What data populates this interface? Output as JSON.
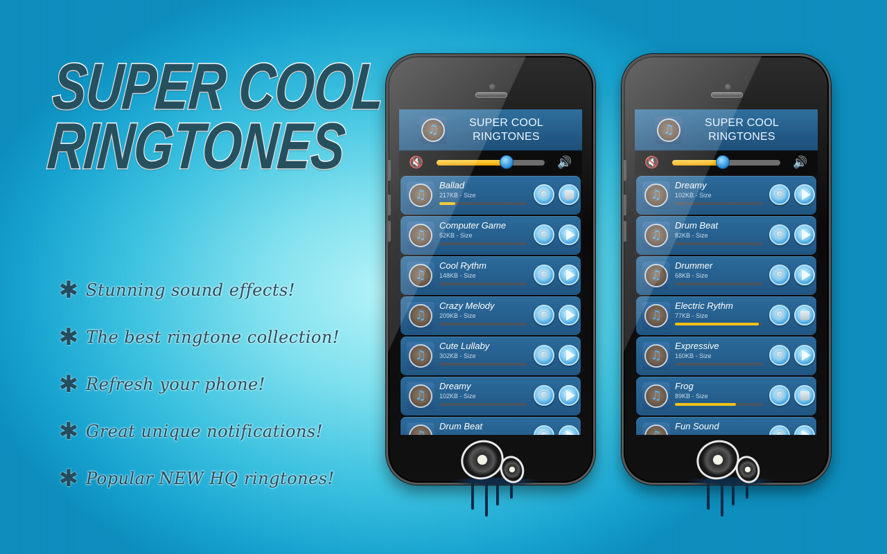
{
  "promo": {
    "title_line1": "SUPER COOL",
    "title_line2": "RINGTONES",
    "bullet_glyph": "✱",
    "features": [
      "Stunning sound effects!",
      "The best ringtone collection!",
      "Refresh your phone!",
      "Great unique notifications!",
      "Popular NEW HQ ringtones!"
    ]
  },
  "icons": {
    "music_note": "♫",
    "mute": "🔇",
    "volume": "🔊",
    "gear": "⚙"
  },
  "colors": {
    "progress_fill": "#f3c21b",
    "accent_blue": "#2a8fd9",
    "title_dark": "#27505f"
  },
  "phones": [
    {
      "app_title_line1": "SUPER COOL",
      "app_title_line2": "RINGTONES",
      "volume_percent": 65,
      "songs": [
        {
          "name": "Ballad",
          "size": "217KB - Size",
          "progress": 0.18,
          "state": "stop"
        },
        {
          "name": "Computer Game",
          "size": "52KB - Size",
          "progress": 0,
          "state": "play"
        },
        {
          "name": "Cool Rythm",
          "size": "148KB - Size",
          "progress": 0,
          "state": "play"
        },
        {
          "name": "Crazy Melody",
          "size": "209KB - Size",
          "progress": 0,
          "state": "play"
        },
        {
          "name": "Cute Lullaby",
          "size": "302KB - Size",
          "progress": 0,
          "state": "play"
        },
        {
          "name": "Dreamy",
          "size": "102KB - Size",
          "progress": 0,
          "state": "play"
        },
        {
          "name": "Drum Beat",
          "size": "",
          "progress": 0,
          "state": "play"
        }
      ]
    },
    {
      "app_title_line1": "SUPER COOL",
      "app_title_line2": "RINGTONES",
      "volume_percent": 47,
      "songs": [
        {
          "name": "Dreamy",
          "size": "102KB - Size",
          "progress": 0,
          "state": "play"
        },
        {
          "name": "Drum Beat",
          "size": "82KB - Size",
          "progress": 0,
          "state": "play"
        },
        {
          "name": "Drummer",
          "size": "68KB - Size",
          "progress": 0,
          "state": "play"
        },
        {
          "name": "Electric Rythm",
          "size": "77KB - Size",
          "progress": 0.96,
          "state": "stop"
        },
        {
          "name": "Expressive",
          "size": "160KB - Size",
          "progress": 0,
          "state": "play"
        },
        {
          "name": "Frog",
          "size": "89KB - Size",
          "progress": 0.7,
          "state": "stop"
        },
        {
          "name": "Fun Sound",
          "size": "",
          "progress": 0,
          "state": "play"
        }
      ]
    }
  ]
}
